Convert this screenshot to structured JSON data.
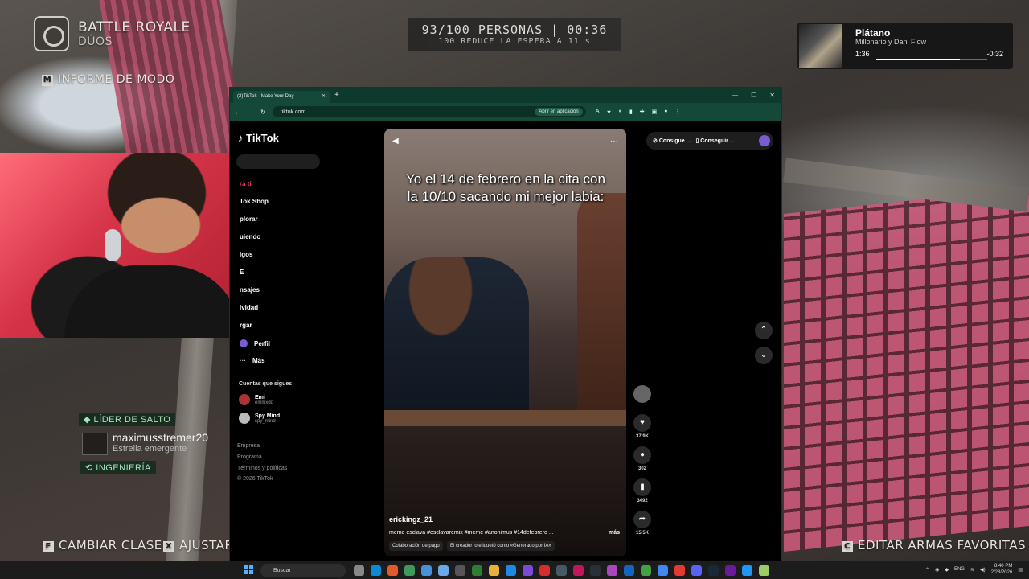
{
  "game": {
    "mode_title": "BATTLE ROYALE",
    "mode_sub": "DÚOS",
    "mode_report_key": "M",
    "mode_report": "INFORME DE MODO",
    "queue_main": "93/100 PERSONAS | 00:36",
    "queue_sub": "100 REDUCE LA ESPERA A 11 s",
    "jump_leader": "LÍDER DE SALTO",
    "player_name": "maximusstremer20",
    "player_rank": "Estrella emergente",
    "engineering": "INGENIERÍA",
    "change_class_key": "F",
    "change_class": "CAMBIAR CLASE",
    "adjust_key": "X",
    "adjust": "AJUSTAR",
    "edit_weapons_key": "C",
    "edit_weapons": "EDITAR ARMAS FAVORITAS"
  },
  "media": {
    "title": "Plátano",
    "artist": "Millonario y Dani Flow",
    "elapsed": "1:36",
    "remaining": "-0:32",
    "progress": 0.75
  },
  "browser": {
    "tab_title": "(2)TikTok - Make Your Day",
    "new_tab": "+",
    "url": "tiktok.com",
    "open_app": "Abrir en aplicación",
    "win_min": "—",
    "win_max": "☐",
    "win_close": "✕"
  },
  "tiktok": {
    "logo": "TikTok",
    "nav": [
      "ra ti",
      "Tok Shop",
      "plorar",
      "uiendo",
      "igos",
      "E",
      "nsajes",
      "ividad",
      "rgar",
      "Perfil",
      "Más"
    ],
    "following_title": "Cuentas que sigues",
    "accounts": [
      {
        "name": "Emi",
        "handle": "emmxdd"
      },
      {
        "name": "Spy Mind",
        "handle": "spy_mind"
      }
    ],
    "footer": [
      "Empresa",
      "Programa",
      "Términos y políticas",
      "© 2026 TikTok"
    ],
    "top_pill_1": "Consigue ...",
    "top_pill_2": "Conseguir ...",
    "video": {
      "caption": "Yo el 14 de febrero en la cita con la 10/10 sacando mi mejor labia:",
      "author": "erickingz_21",
      "description": "meme esclava #esclavaremix #meme #anonimus #14defebrero ...",
      "more": "más",
      "chip1": "Colaboración de pago",
      "chip2": "El creador lo etiquetó como «Generado por IA»",
      "likes": "37.9K",
      "comments": "302",
      "saves": "3492",
      "shares": "15.5K"
    }
  },
  "taskbar": {
    "search": "Buscar",
    "lang": "ENG",
    "time": "8:40 PM",
    "date": "2/28/2026"
  }
}
